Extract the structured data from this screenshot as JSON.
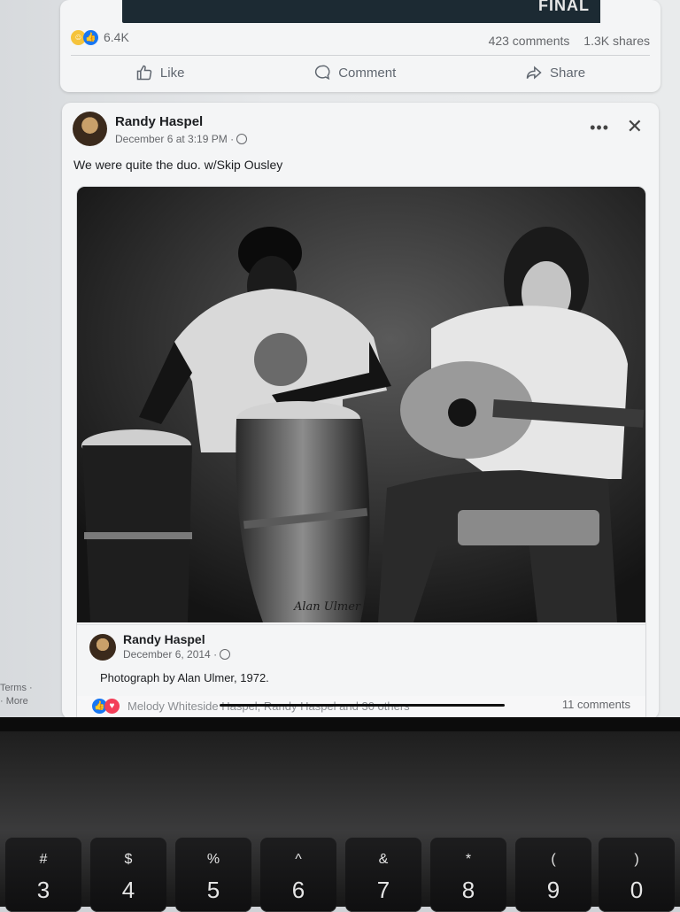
{
  "previous_post": {
    "media_score": "FINAL",
    "reaction_count": "6.4K",
    "comments": "423 comments",
    "shares": "1.3K shares",
    "actions": {
      "like": "Like",
      "comment": "Comment",
      "share": "Share"
    }
  },
  "post": {
    "author": "Randy Haspel",
    "date": "December 6 at 3:19 PM",
    "text": "We were quite the duo. w/Skip Ousley",
    "shared": {
      "author": "Randy Haspel",
      "date": "December 6, 2014",
      "caption": "Photograph by Alan Ulmer, 1972.",
      "photo_signature": "Alan Ulmer"
    },
    "reactions_people": "Melody Whiteside Haspel, Randy Haspel and 30 others",
    "comments": "11 comments"
  },
  "left_links": {
    "terms": "Terms ·",
    "more": "· More"
  },
  "keyboard": [
    {
      "sym": "#",
      "num": "3"
    },
    {
      "sym": "$",
      "num": "4"
    },
    {
      "sym": "%",
      "num": "5"
    },
    {
      "sym": "^",
      "num": "6"
    },
    {
      "sym": "&",
      "num": "7"
    },
    {
      "sym": "*",
      "num": "8"
    },
    {
      "sym": "(",
      "num": "9"
    },
    {
      "sym": ")",
      "num": "0"
    }
  ]
}
